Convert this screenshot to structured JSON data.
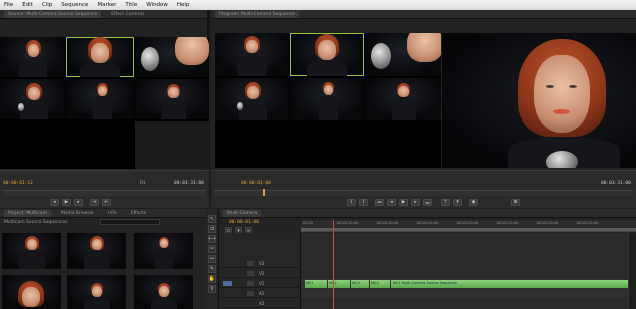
{
  "menu": {
    "items": [
      "File",
      "Edit",
      "Clip",
      "Sequence",
      "Marker",
      "Title",
      "Window",
      "Help"
    ]
  },
  "source_monitor": {
    "tab_label": "Source: Multi-Camera Source Sequence",
    "tab2_label": "Effect Controls",
    "timecode_left": "00:00:01:12",
    "timecode_right": "00:03:31:00",
    "fit_label": "Fit"
  },
  "program_monitor": {
    "tab_label": "Program: Multi-Camera Sequence",
    "timecode_left": "00:00:01:00",
    "timecode_right": "00:03:31:00"
  },
  "project_panel": {
    "tabs": [
      "Project: Multicam",
      "Media Browser",
      "Info",
      "Effects"
    ],
    "path_label": "Multicam Source Sequences"
  },
  "timeline": {
    "tab_label": "Multi-Camera",
    "timecode": "00:00:01:00",
    "ruler_labels": [
      "00:00",
      "00:00:15:00",
      "00:00:30:00",
      "00:00:45:00",
      "00:01:00:00",
      "00:01:15:00",
      "00:01:30:00",
      "00:01:45:00"
    ],
    "tracks": [
      "V3",
      "V2",
      "V1",
      "A1",
      "A2"
    ],
    "clip_labels": [
      "MC1",
      "MC2",
      "MC3",
      "MC4",
      "MC1 Multi-Camera Source Sequence"
    ]
  },
  "colors": {
    "timecode": "#e7a13d",
    "selection": "#9bc243",
    "clip": "#6cb95a",
    "playhead": "#d24b3c"
  }
}
